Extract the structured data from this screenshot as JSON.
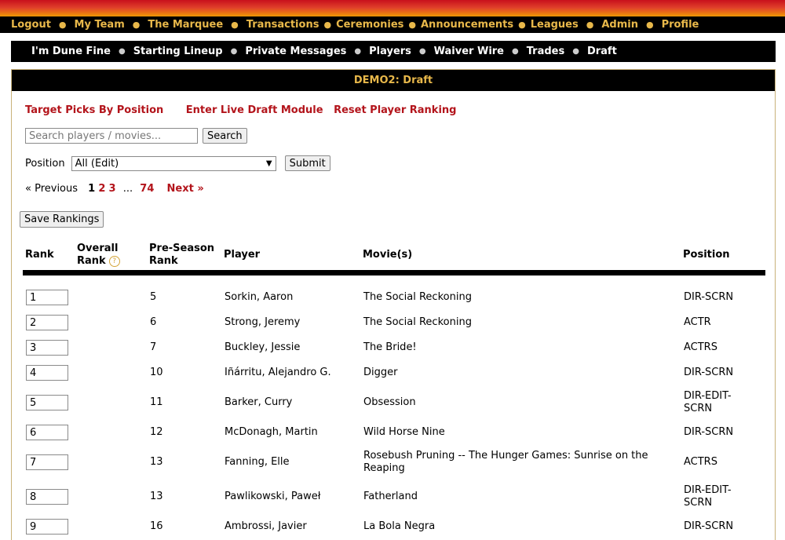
{
  "main_nav": [
    "Logout",
    "My Team",
    "The Marquee",
    "Transactions",
    "Ceremonies",
    "Announcements",
    "Leagues",
    "Admin",
    "Profile"
  ],
  "sub_nav": [
    "I'm Dune Fine",
    "Starting Lineup",
    "Private Messages",
    "Players",
    "Waiver Wire",
    "Trades",
    "Draft"
  ],
  "panel": {
    "title": "DEMO2: Draft",
    "links": [
      "Target Picks By Position",
      "Enter Live Draft Module",
      "Reset Player Ranking"
    ],
    "search": {
      "placeholder": "Search players / movies...",
      "button": "Search"
    },
    "position": {
      "label": "Position",
      "selected": "All (Edit)",
      "button": "Submit"
    },
    "pager": {
      "prev": "« Previous",
      "current": "1",
      "pages": [
        "2",
        "3"
      ],
      "ellipsis": "...",
      "last": "74",
      "next": "Next »"
    },
    "save_button": "Save Rankings"
  },
  "table": {
    "headers": {
      "rank": "Rank",
      "overall_1": "Overall",
      "overall_2": "Rank",
      "help": "?",
      "preseason_1": "Pre-Season",
      "preseason_2": "Rank",
      "player": "Player",
      "movies": "Movie(s)",
      "position": "Position"
    },
    "rows": [
      {
        "rank": "1",
        "preseason": "5",
        "player": "Sorkin, Aaron",
        "movie": "The Social Reckoning",
        "position": "DIR-SCRN"
      },
      {
        "rank": "2",
        "preseason": "6",
        "player": "Strong, Jeremy",
        "movie": "The Social Reckoning",
        "position": "ACTR"
      },
      {
        "rank": "3",
        "preseason": "7",
        "player": "Buckley, Jessie",
        "movie": "The Bride!",
        "position": "ACTRS"
      },
      {
        "rank": "4",
        "preseason": "10",
        "player": "Iñárritu, Alejandro G.",
        "movie": "Digger",
        "position": "DIR-SCRN"
      },
      {
        "rank": "5",
        "preseason": "11",
        "player": "Barker, Curry",
        "movie": "Obsession",
        "position": "DIR-EDIT-SCRN"
      },
      {
        "rank": "6",
        "preseason": "12",
        "player": "McDonagh, Martin",
        "movie": "Wild Horse Nine",
        "position": "DIR-SCRN"
      },
      {
        "rank": "7",
        "preseason": "13",
        "player": "Fanning, Elle",
        "movie": "Rosebush Pruning -- The Hunger Games: Sunrise on the Reaping",
        "position": "ACTRS"
      },
      {
        "rank": "8",
        "preseason": "13",
        "player": "Pawlikowski, Paweł",
        "movie": "Fatherland",
        "position": "DIR-EDIT-SCRN"
      },
      {
        "rank": "9",
        "preseason": "16",
        "player": "Ambrossi, Javier",
        "movie": "La Bola Negra",
        "position": "DIR-SCRN"
      }
    ]
  },
  "colors": {
    "accent_gold": "#e8b84a",
    "link_red": "#b3141b",
    "bar_black": "#000000"
  }
}
